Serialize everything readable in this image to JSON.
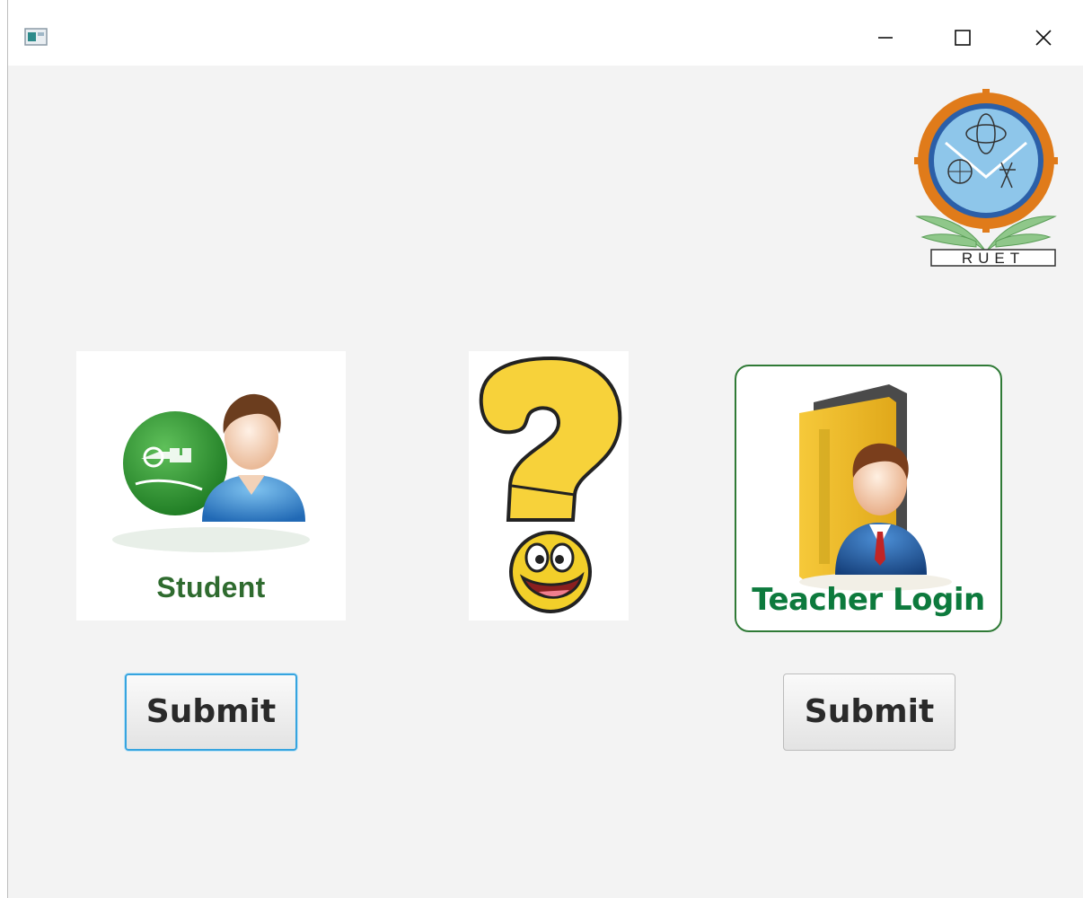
{
  "window": {
    "title": "",
    "controls": [
      "minimize",
      "maximize",
      "close"
    ]
  },
  "logo": {
    "text": "RUET"
  },
  "student": {
    "label": "Student",
    "submit_label": "Submit"
  },
  "teacher": {
    "label": "Teacher Login",
    "submit_label": "Submit"
  },
  "colors": {
    "background": "#f3f3f3",
    "student_label": "#2f6b2f",
    "teacher_label": "#0d7a3d",
    "focus_ring": "#36a4df"
  }
}
